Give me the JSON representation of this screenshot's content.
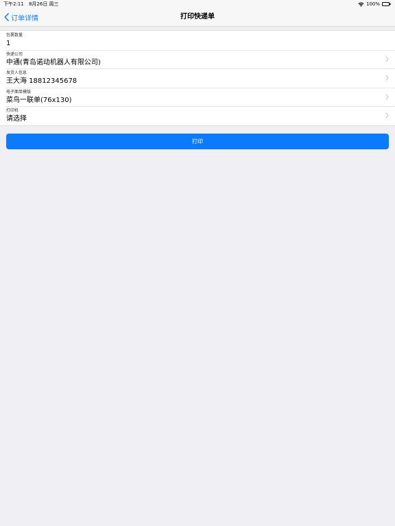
{
  "status_bar": {
    "time": "下午2:11",
    "date": "8月26日 周三",
    "battery": "100%"
  },
  "nav": {
    "back_label": "订单详情",
    "title": "打印快递单"
  },
  "form": {
    "rows": [
      {
        "label": "包裹数量",
        "value": "1",
        "has_chevron": false
      },
      {
        "label": "快递公司",
        "value": "中通(青岛诺动机器人有限公司)",
        "has_chevron": true
      },
      {
        "label": "发货人信息",
        "value": "王大海 18812345678",
        "has_chevron": true
      },
      {
        "label": "电子面单模版",
        "value": "菜鸟一联单(76x130)",
        "has_chevron": true
      },
      {
        "label": "打印机",
        "value": "请选择",
        "has_chevron": true
      }
    ]
  },
  "actions": {
    "print_label": "打印"
  },
  "colors": {
    "accent": "#0a7aff",
    "link": "#1a7cf5",
    "background": "#efeff4"
  }
}
